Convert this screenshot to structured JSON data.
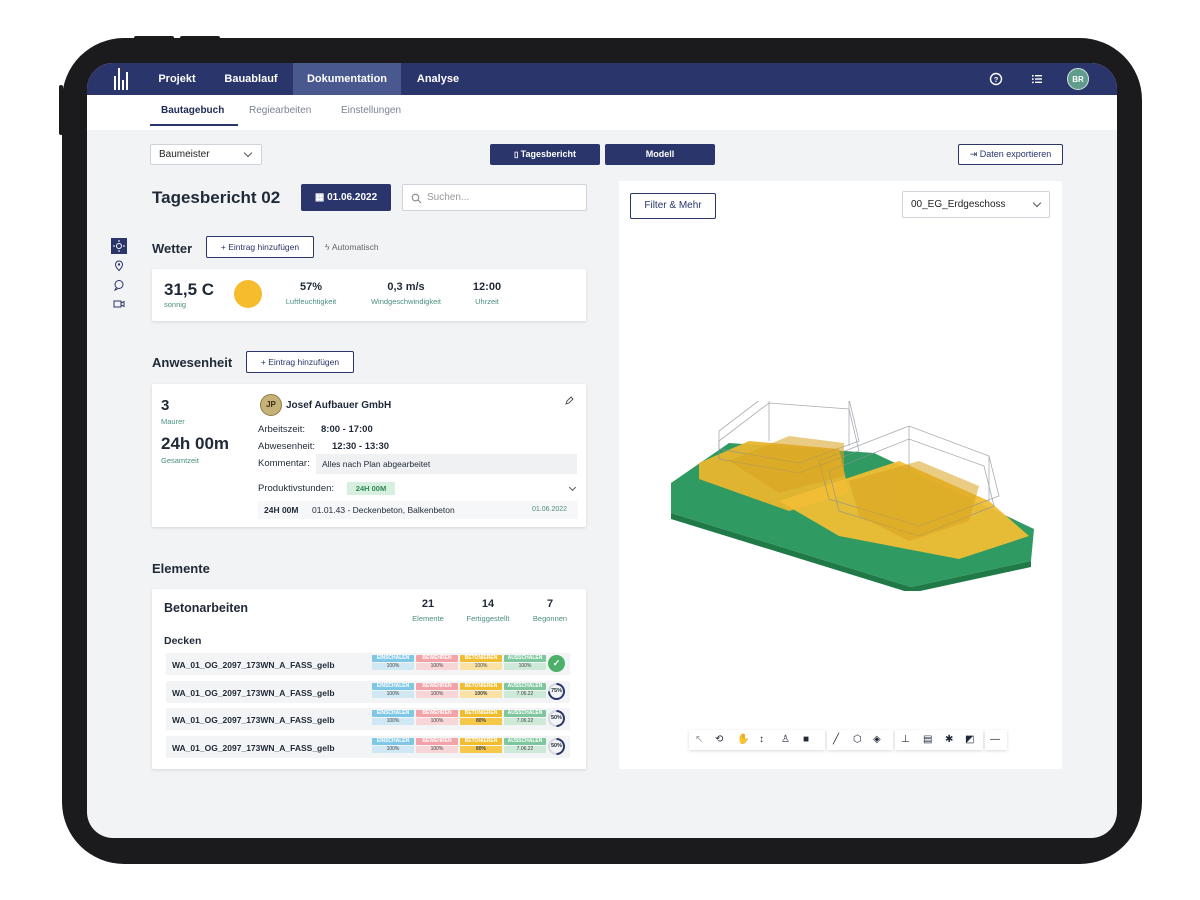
{
  "nav": {
    "tabs": [
      {
        "label": "Projekt"
      },
      {
        "label": "Bauablauf"
      },
      {
        "label": "Dokumentation"
      },
      {
        "label": "Analyse"
      }
    ],
    "avatar": "BR"
  },
  "subnav": {
    "tabs": [
      {
        "label": "Bautagebuch"
      },
      {
        "label": "Regiearbeiten"
      },
      {
        "label": "Einstellungen"
      }
    ]
  },
  "toolbar": {
    "role_select": "Baumeister",
    "tagesbericht": "Tagesbericht",
    "modell": "Modell",
    "export": "Daten exportieren"
  },
  "report": {
    "title": "Tagesbericht 02",
    "date": "01.06.2022",
    "search_placeholder": "Suchen..."
  },
  "weather": {
    "heading": "Wetter",
    "add": "+ Eintrag hinzufügen",
    "auto": "Automatisch",
    "temp": "31,5 C",
    "condition": "sonnig",
    "humidity": "57%",
    "humidity_label": "Luftfeuchtigkeit",
    "wind": "0,3 m/s",
    "wind_label": "Windgeschwindigkeit",
    "time": "12:00",
    "time_label": "Uhrzeit"
  },
  "attendance": {
    "heading": "Anwesenheit",
    "add": "+ Eintrag hinzufügen",
    "count": "3",
    "count_label": "Maurer",
    "total": "24h 00m",
    "total_label": "Gesamtzeit",
    "company_initials": "JP",
    "company": "Josef Aufbauer GmbH",
    "work_label": "Arbeitszeit:",
    "work_value": "8:00 - 17:00",
    "absent_label": "Abwesenheit:",
    "absent_value": "12:30 - 13:30",
    "comment_label": "Kommentar:",
    "comment_value": "Alles nach Plan abgearbeitet",
    "productive_label": "Produktivstunden:",
    "productive_value": "24H 00M",
    "entry_hours": "24H 00M",
    "entry_text": "01.01.43 - Deckenbeton, Balkenbeton",
    "entry_date": "01.06.2022"
  },
  "elements": {
    "heading": "Elemente",
    "group": "Betonarbeiten",
    "stats": [
      {
        "value": "21",
        "label": "Elemente"
      },
      {
        "value": "14",
        "label": "Fertiggestellt"
      },
      {
        "value": "7",
        "label": "Begonnen"
      }
    ],
    "subgroup": "Decken",
    "stage_labels": [
      "EINSCHALEN",
      "BEWEHREN",
      "BETONIEREN",
      "AUSSCHALEN"
    ],
    "rows": [
      {
        "name": "WA_01_OG_2097_173WN_A_FASS_gelb",
        "values": [
          "100%",
          "100%",
          "100%",
          "100%"
        ],
        "status": "done",
        "progress": 100
      },
      {
        "name": "WA_01_OG_2097_173WN_A_FASS_gelb",
        "values": [
          "100%",
          "100%",
          "100%",
          "7.06.22"
        ],
        "status": "75%",
        "progress": 75
      },
      {
        "name": "WA_01_OG_2097_173WN_A_FASS_gelb",
        "values": [
          "100%",
          "100%",
          "80%",
          "7.06.22"
        ],
        "status": "50%",
        "progress": 50
      },
      {
        "name": "WA_01_OG_2097_173WN_A_FASS_gelb",
        "values": [
          "100%",
          "100%",
          "80%",
          "7.06.22"
        ],
        "status": "50%",
        "progress": 50
      }
    ]
  },
  "model": {
    "filter": "Filter & Mehr",
    "level": "00_EG_Erdgeschoss"
  },
  "colors": {
    "navy": "#29356b",
    "teal": "#4a8f80",
    "green_model": "#2f9b62",
    "yellow_model": "#e8b52e"
  }
}
